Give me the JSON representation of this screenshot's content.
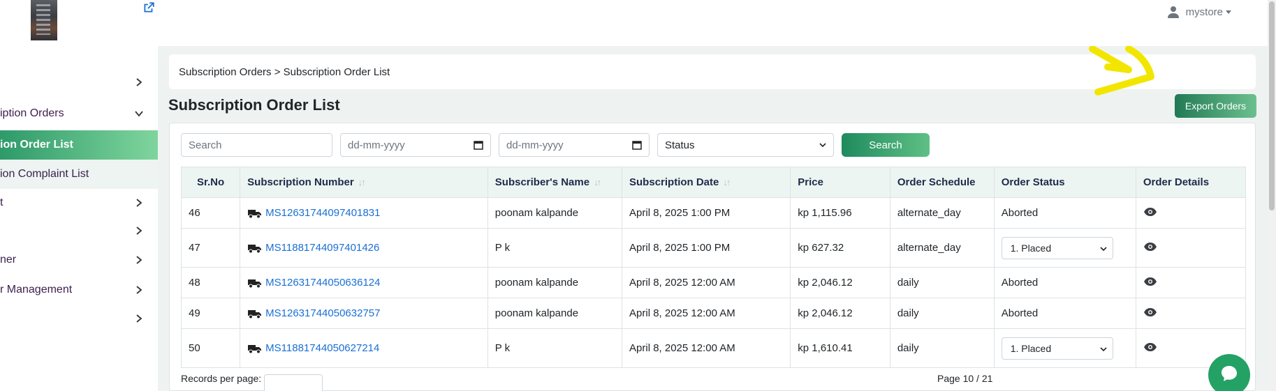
{
  "sidebar": {
    "items": [
      {
        "label": "",
        "active": false
      },
      {
        "label": "iption Orders"
      },
      {
        "label": "ion Order List"
      },
      {
        "label": "ion Complaint List"
      },
      {
        "label": "t"
      },
      {
        "label": ""
      },
      {
        "label": "ner"
      },
      {
        "label": "r Management"
      },
      {
        "label": ""
      }
    ]
  },
  "topbar": {
    "user_name": "mystore"
  },
  "breadcrumb": {
    "text": "Subscription Orders > Subscription Order List"
  },
  "page": {
    "title": "Subscription Order List",
    "export_label": "Export Orders"
  },
  "filters": {
    "search_placeholder": "Search",
    "date_from_placeholder": "dd-mm-yyyy",
    "date_to_placeholder": "dd-mm-yyyy",
    "status_value": "Status",
    "search_button": "Search"
  },
  "table": {
    "headers": [
      "Sr.No",
      "Subscription Number",
      "Subscriber's Name",
      "Subscription Date",
      "Price",
      "Order Schedule",
      "Order Status",
      "Order Details"
    ],
    "rows": [
      {
        "sr": "46",
        "number": "MS12631744097401831",
        "name": "poonam kalpande",
        "date": "April 8, 2025 1:00 PM",
        "price": "kp 1,115.96",
        "schedule": "alternate_day",
        "status": "Aborted",
        "status_select": false
      },
      {
        "sr": "47",
        "number": "MS11881744097401426",
        "name": "P k",
        "date": "April 8, 2025 1:00 PM",
        "price": "kp 627.32",
        "schedule": "alternate_day",
        "status": "1. Placed",
        "status_select": true
      },
      {
        "sr": "48",
        "number": "MS12631744050636124",
        "name": "poonam kalpande",
        "date": "April 8, 2025 12:00 AM",
        "price": "kp 2,046.12",
        "schedule": "daily",
        "status": "Aborted",
        "status_select": false
      },
      {
        "sr": "49",
        "number": "MS12631744050632757",
        "name": "poonam kalpande",
        "date": "April 8, 2025 12:00 AM",
        "price": "kp 2,046.12",
        "schedule": "daily",
        "status": "Aborted",
        "status_select": false
      },
      {
        "sr": "50",
        "number": "MS11881744050627214",
        "name": "P k",
        "date": "April 8, 2025 12:00 AM",
        "price": "kp 1,610.41",
        "schedule": "daily",
        "status": "1. Placed",
        "status_select": true
      }
    ]
  },
  "footer": {
    "records_label": "Records per page:",
    "pager_text": "Page 10 / 21"
  },
  "colors": {
    "accent": "#2e9a6a",
    "link": "#1a6fd6",
    "annotation": "#f2e600"
  },
  "icons": [
    "external-link-icon",
    "chevron-right-icon",
    "chevron-down-icon",
    "user-icon",
    "calendar-icon",
    "truck-icon",
    "eye-icon",
    "chat-icon",
    "sort-icon"
  ]
}
